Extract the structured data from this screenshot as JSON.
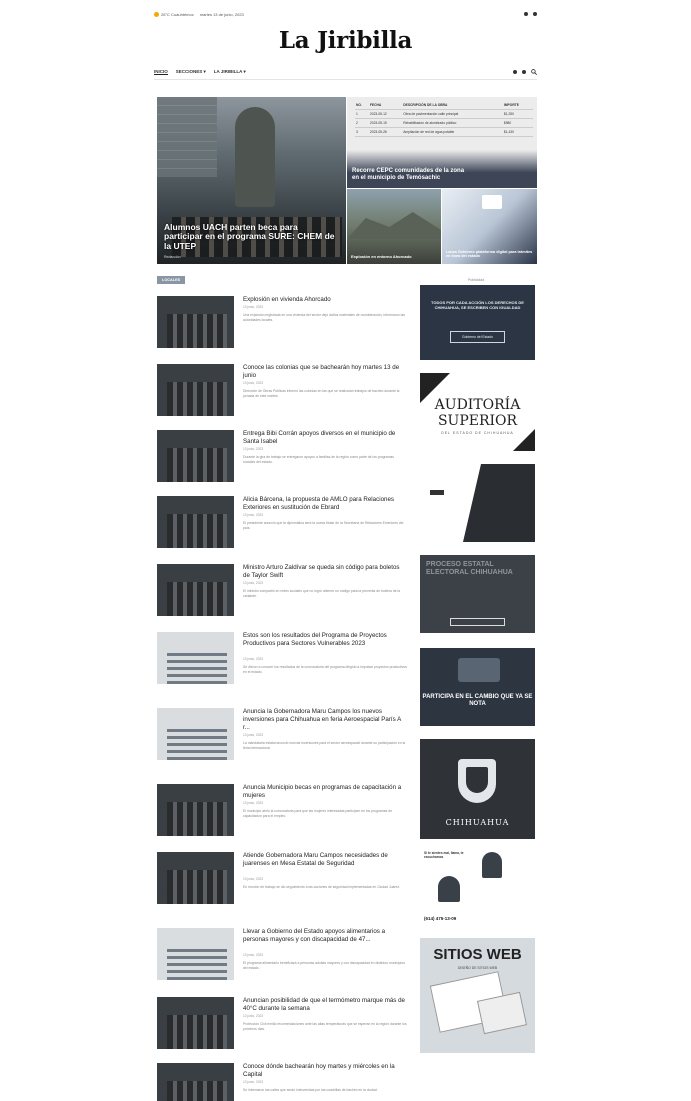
{
  "topbar": {
    "weather": "26°C Cuauhtémoc",
    "date": "martes 13 de junio, 2023"
  },
  "site": {
    "logo": "La Jiribilla"
  },
  "nav": {
    "items": [
      "INICIO",
      "SECCIONES ▾",
      "LA JIRIBILLA ▾"
    ]
  },
  "hero": {
    "main": {
      "title": "Alumnos UACH parten beca para participar en el programa SURE: CHEM de la UTEP",
      "meta": "Redacción"
    },
    "top_right": {
      "title": "Recorre CEPC comunidades de la zona en el municipio de Temósachic"
    },
    "bottom_left": {
      "title": "Explosión en entorno Ahorcado"
    },
    "bottom_right": {
      "title": "Lanza Gobierno plataforma digital para trámites en línea del estado"
    },
    "table": {
      "headers": [
        "NO.",
        "FECHA",
        "DESCRIPCIÓN DE LA OBRA",
        "IMPORTE"
      ],
      "rows": [
        [
          "1",
          "2023-05-12",
          "Obra de pavimentación calle principal",
          "$1,250"
        ],
        [
          "2",
          "2023-05-19",
          "Rehabilitación de alumbrado público",
          "$980"
        ],
        [
          "3",
          "2023-05-26",
          "Ampliación de red de agua potable",
          "$1,430"
        ]
      ]
    }
  },
  "section_tag": "LOCALES",
  "ads_label": "Publicidad",
  "articles": [
    {
      "title": "Explosión en vivienda Ahorcado",
      "date": "13 junio, 2023",
      "excerpt": "Una explosión registrada en una vivienda del sector dejó daños materiales de consideración, informaron las autoridades locales."
    },
    {
      "title": "Conoce las colonias que se bachearán hoy martes 13 de junio",
      "date": "13 junio, 2023",
      "excerpt": "Dirección de Obras Públicas informó las colonias en las que se realizarán trabajos de bacheo durante la jornada de este martes."
    },
    {
      "title": "Entrega Bibi Corrán apoyos diversos en el municipio de Santa Isabel",
      "date": "13 junio, 2023",
      "excerpt": "Durante la gira de trabajo se entregaron apoyos a familias de la región como parte de los programas sociales del estado."
    },
    {
      "title": "Alicia Bárcena, la propuesta de AMLO para Relaciones Exteriores en sustitución de Ebrard",
      "date": "13 junio, 2023",
      "excerpt": "El presidente anunció que la diplomática será la nueva titular de la Secretaría de Relaciones Exteriores del país."
    },
    {
      "title": "Ministro Arturo Zaldívar se queda sin código para boletos de Taylor Swift",
      "date": "13 junio, 2023",
      "excerpt": "El ministro compartió en redes sociales que no logró obtener un código para la preventa de boletos de la cantante."
    },
    {
      "title": "Estos son los resultados del Programa de Proyectos Productivos para Sectores Vulnerables 2023",
      "date": "13 junio, 2023",
      "excerpt": "Se dieron a conocer los resultados de la convocatoria del programa dirigido a impulsar proyectos productivos en el estado."
    },
    {
      "title": "Anuncia la Gobernadora Maru Campos los nuevos inversiones para Chihuahua en feria Aeroespacial París A r...",
      "date": "13 junio, 2023",
      "excerpt": "La mandataria estatal anunció nuevas inversiones para el sector aeroespacial durante su participación en la feria internacional."
    },
    {
      "title": "Anuncia Municipio becas en programas de capacitación a mujeres",
      "date": "13 junio, 2023",
      "excerpt": "El municipio abrió la convocatoria para que las mujeres interesadas participen en los programas de capacitación para el empleo."
    },
    {
      "title": "Atiende Gobernadora Maru Campos necesidades de juarenses en Mesa Estatal de Seguridad",
      "date": "13 junio, 2023",
      "excerpt": "En reunión de trabajo se dio seguimiento a las acciones de seguridad implementadas en Ciudad Juárez."
    },
    {
      "title": "Llevar a Gobierno del Estado apoyos alimentarios a personas mayores y con discapacidad de 47...",
      "date": "13 junio, 2023",
      "excerpt": "El programa alimentario beneficiará a personas adultas mayores y con discapacidad en distintos municipios del estado."
    },
    {
      "title": "Anuncian posibilidad de que el termómetro marque más de 40°C durante la semana",
      "date": "13 junio, 2023",
      "excerpt": "Protección Civil emitió recomendaciones ante las altas temperaturas que se esperan en la región durante los próximos días."
    },
    {
      "title": "Conoce dónde bachearán hoy martes y miércoles en la Capital",
      "date": "13 junio, 2023",
      "excerpt": "Se informaron las calles que serán intervenidas por las cuadrillas de bacheo en la ciudad."
    }
  ],
  "ads": {
    "ad1": {
      "text": "TODOS POR CADA ACCIÓN LOS DERECHOS DE CHIHUAHUA, SE ESCRIBEN CON IGUALDAD",
      "logo": "Gobierno del Estado"
    },
    "ad2": {
      "line1": "AUDITORÍA",
      "line2": "SUPERIOR",
      "line3": "DEL ESTADO DE CHIHUAHUA"
    },
    "ad4": {
      "text": "PROCESO ESTATAL ELECTORAL CHIHUAHUA"
    },
    "ad5": {
      "text": "PARTICIPA EN EL CAMBIO QUE YA SE NOTA"
    },
    "ad6": {
      "text": "CHIHUAHUA"
    },
    "ad7": {
      "text": "Si te sientes mal, llama, te escuchamos",
      "phone": "(614) 475-13-09"
    },
    "ad8": {
      "title": "SITIOS WEB",
      "subtitle": "DISEÑO DE SITIOS WEB"
    }
  }
}
